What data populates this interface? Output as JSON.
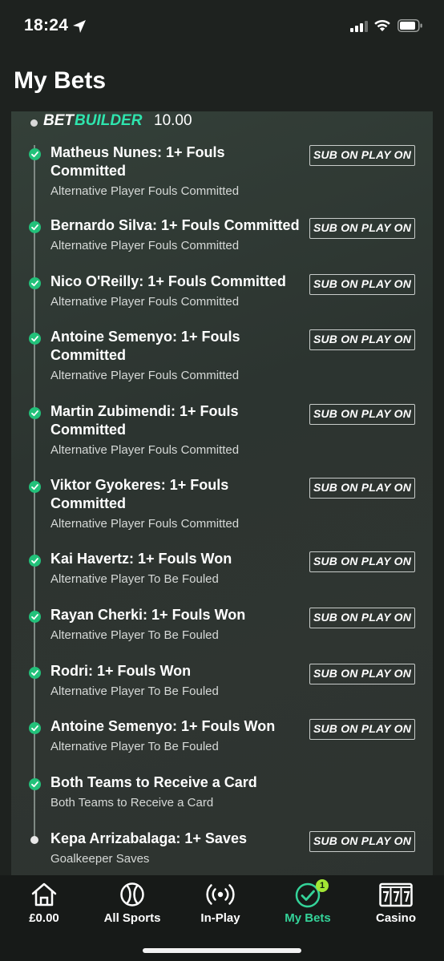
{
  "status_bar": {
    "time": "18:24"
  },
  "page": {
    "title": "My Bets"
  },
  "bet_builder": {
    "label_bet": "BET",
    "label_builder": "BUILDER",
    "odds": "10.00",
    "accent_color": "#2ee5ae"
  },
  "legs": [
    {
      "title": [
        "Matheus Nunes: 1+ Fouls",
        "Committed"
      ],
      "market": "Alternative Player Fouls Committed",
      "status": "won",
      "sub_on_play_on": "SUB ON PLAY ON"
    },
    {
      "title": [
        "Bernardo Silva: 1+ Fouls Committed"
      ],
      "market": "Alternative Player Fouls Committed",
      "status": "won",
      "sub_on_play_on": "SUB ON PLAY ON"
    },
    {
      "title": [
        "Nico O'Reilly: 1+ Fouls Committed"
      ],
      "market": "Alternative Player Fouls Committed",
      "status": "won",
      "sub_on_play_on": "SUB ON PLAY ON"
    },
    {
      "title": [
        "Antoine Semenyo: 1+ Fouls",
        "Committed"
      ],
      "market": "Alternative Player Fouls Committed",
      "status": "won",
      "sub_on_play_on": "SUB ON PLAY ON"
    },
    {
      "title": [
        "Martin Zubimendi: 1+ Fouls",
        "Committed"
      ],
      "market": "Alternative Player Fouls Committed",
      "status": "won",
      "sub_on_play_on": "SUB ON PLAY ON"
    },
    {
      "title": [
        "Viktor Gyokeres: 1+ Fouls",
        "Committed"
      ],
      "market": "Alternative Player Fouls Committed",
      "status": "won",
      "sub_on_play_on": "SUB ON PLAY ON"
    },
    {
      "title": [
        "Kai Havertz: 1+ Fouls Won"
      ],
      "market": "Alternative Player To Be Fouled",
      "status": "won",
      "sub_on_play_on": "SUB ON PLAY ON"
    },
    {
      "title": [
        "Rayan Cherki: 1+ Fouls Won"
      ],
      "market": "Alternative Player To Be Fouled",
      "status": "won",
      "sub_on_play_on": "SUB ON PLAY ON"
    },
    {
      "title": [
        "Rodri: 1+ Fouls Won"
      ],
      "market": "Alternative Player To Be Fouled",
      "status": "won",
      "sub_on_play_on": "SUB ON PLAY ON"
    },
    {
      "title": [
        "Antoine Semenyo: 1+ Fouls Won"
      ],
      "market": "Alternative Player To Be Fouled",
      "status": "won",
      "sub_on_play_on": "SUB ON PLAY ON"
    },
    {
      "title": [
        "Both Teams to Receive a Card"
      ],
      "market": "Both Teams to Receive a Card",
      "status": "won",
      "sub_on_play_on": ""
    },
    {
      "title": [
        "Kepa Arrizabalaga: 1+ Saves"
      ],
      "market": "Goalkeeper Saves",
      "status": "pending",
      "sub_on_play_on": "SUB ON PLAY ON"
    }
  ],
  "tabbar": {
    "balance": {
      "label": "£0.00",
      "icon": "home-icon"
    },
    "all_sports": {
      "label": "All Sports",
      "icon": "tennis-ball-icon"
    },
    "in_play": {
      "label": "In-Play",
      "icon": "live-broadcast-icon"
    },
    "my_bets": {
      "label": "My Bets",
      "icon": "check-circle-icon",
      "badge": "1",
      "active_color": "#34d399"
    },
    "casino": {
      "label": "Casino",
      "icon": "slot-machine-icon"
    }
  }
}
